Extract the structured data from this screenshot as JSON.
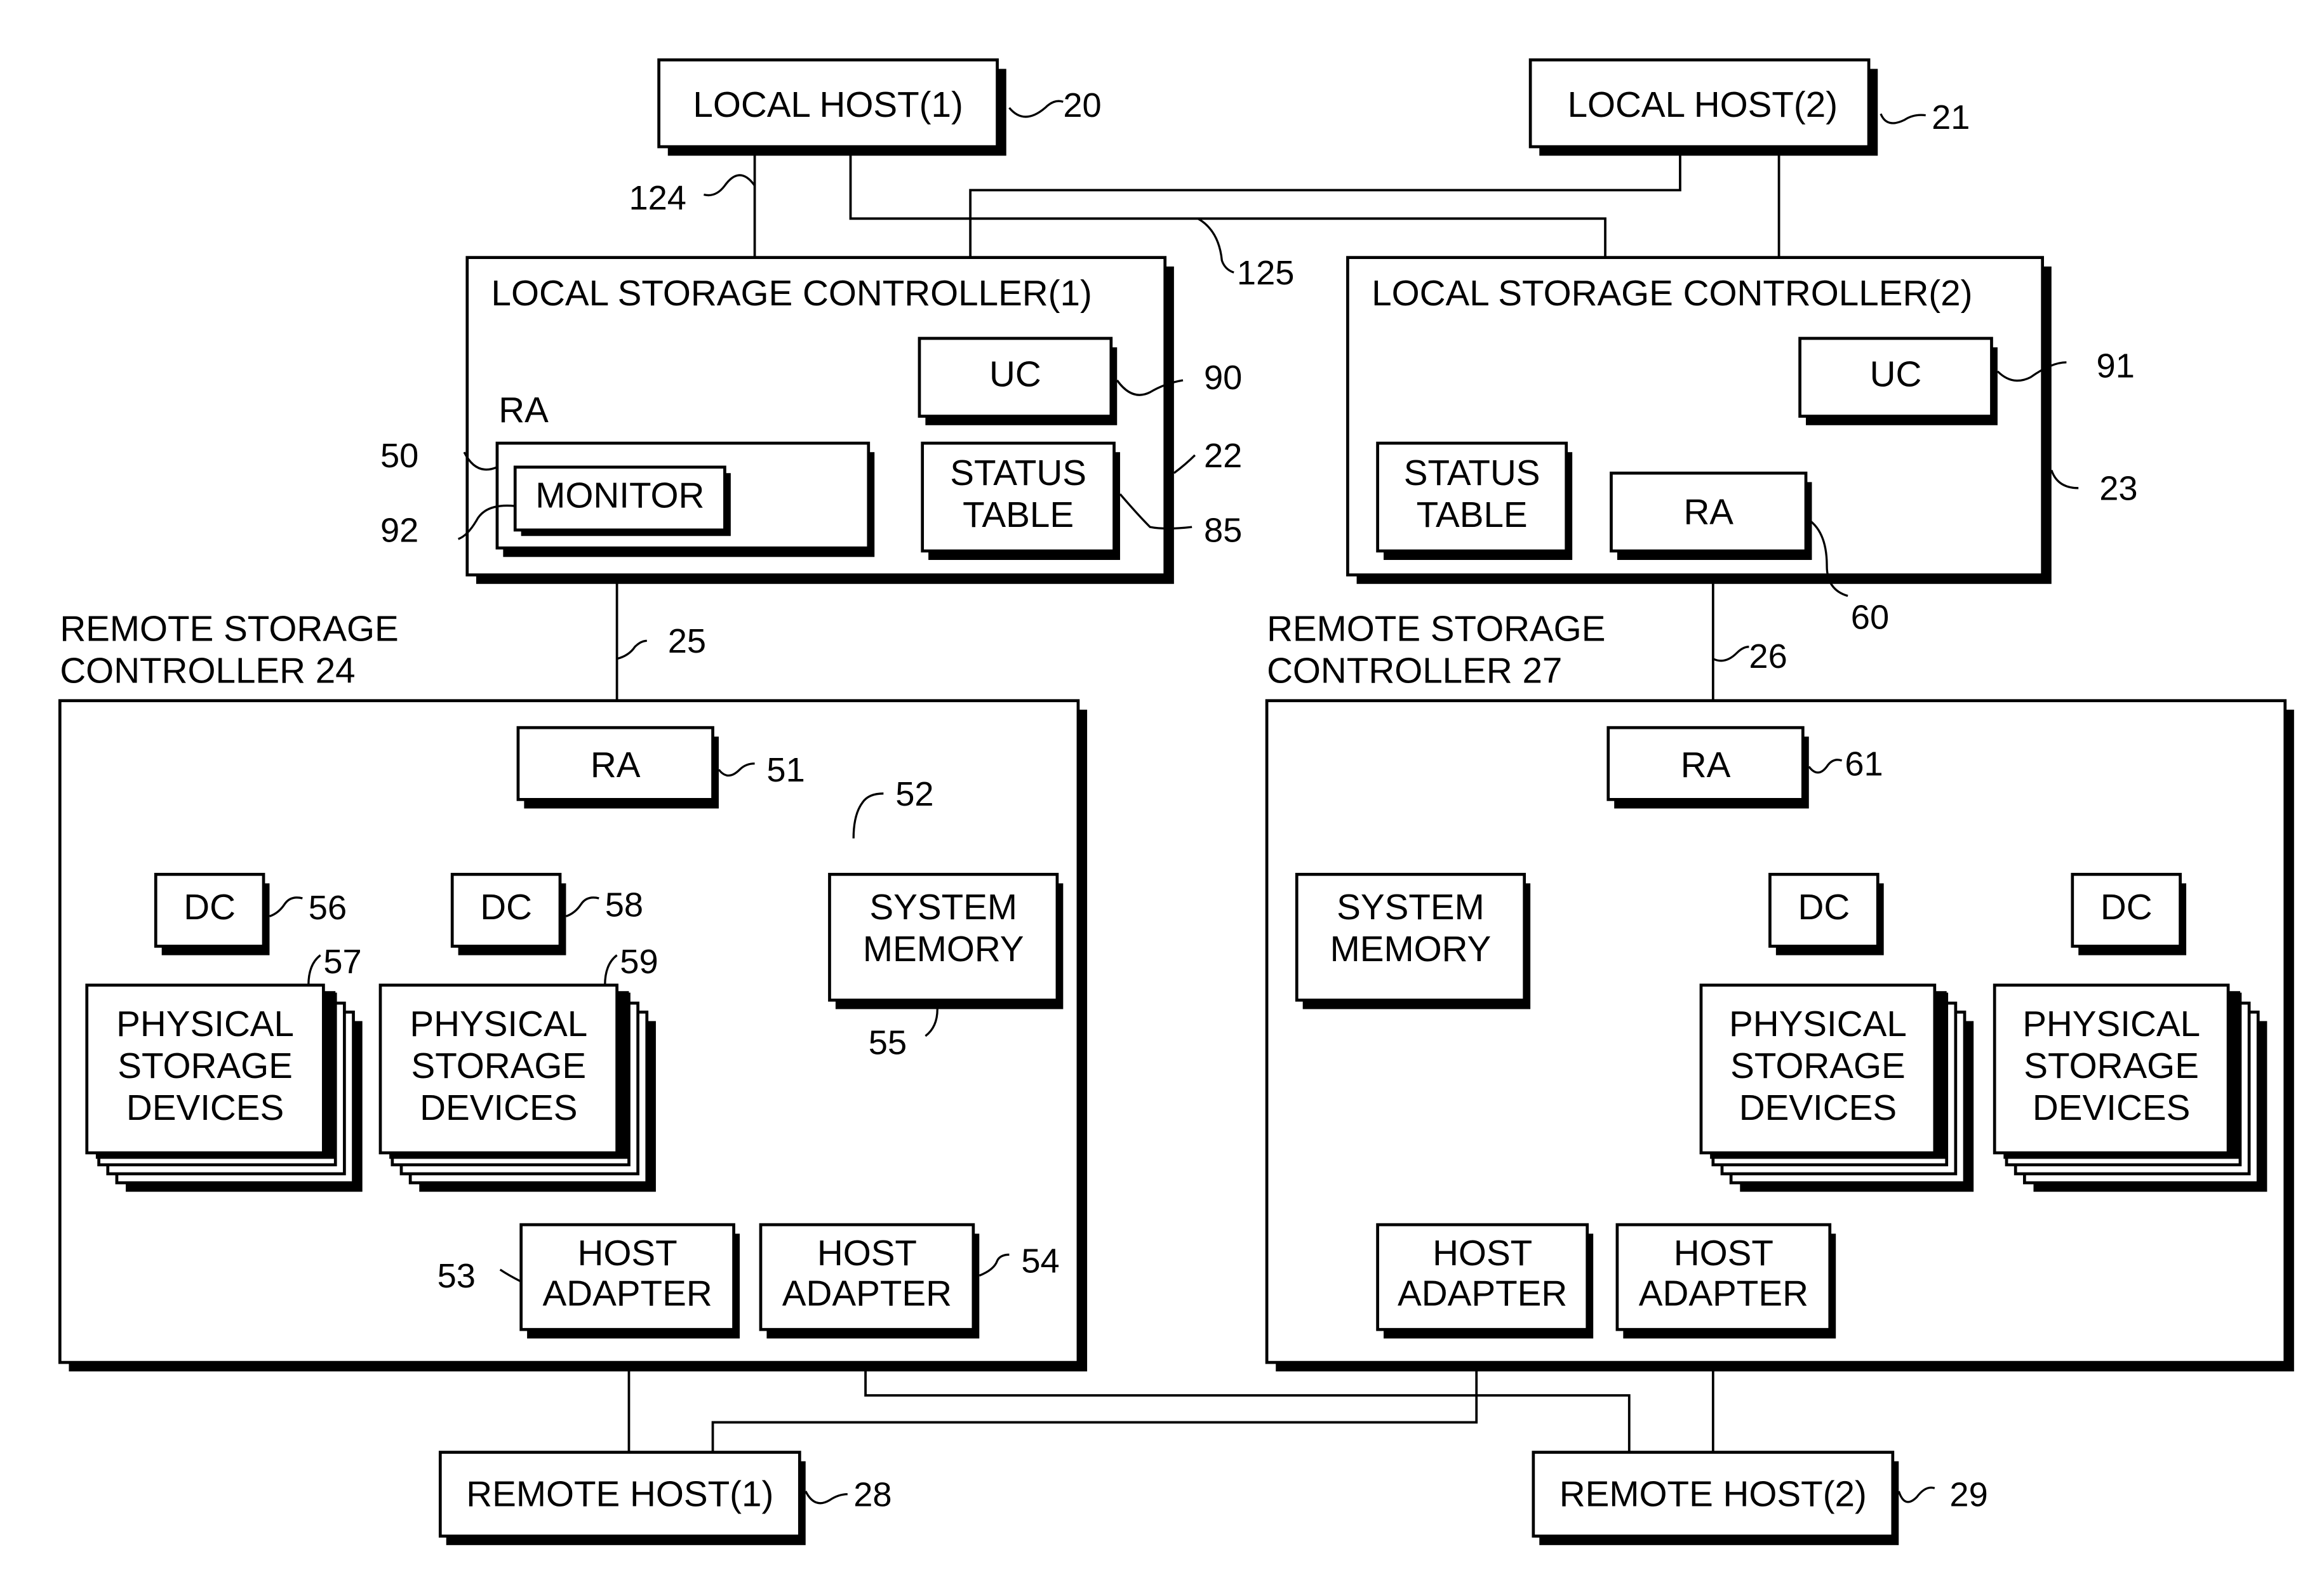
{
  "figure": {
    "local_host_1": {
      "label": "LOCAL HOST(1)",
      "ref": "20"
    },
    "local_host_2": {
      "label": "LOCAL HOST(2)",
      "ref": "21"
    },
    "link_124": "124",
    "link_125": "125",
    "lsc1": {
      "label": "LOCAL STORAGE CONTROLLER(1)",
      "ref": "22",
      "uc": {
        "label": "UC",
        "ref": "90"
      },
      "ra_caption": "RA",
      "ra_ref": "50",
      "monitor": {
        "label": "MONITOR",
        "ref": "92"
      },
      "status_table": {
        "line1": "STATUS",
        "line2": "TABLE",
        "ref": "85"
      }
    },
    "lsc2": {
      "label": "LOCAL STORAGE CONTROLLER(2)",
      "ref": "23",
      "uc": {
        "label": "UC",
        "ref": "91"
      },
      "status_table": {
        "line1": "STATUS",
        "line2": "TABLE"
      },
      "ra": {
        "label": "RA",
        "ref": "60"
      }
    },
    "link_25": "25",
    "link_26": "26",
    "rsc24": {
      "line1": "REMOTE STORAGE",
      "line2": "CONTROLLER 24",
      "ra": {
        "label": "RA",
        "ref": "51"
      },
      "bus_ref": "52",
      "dc_a": {
        "label": "DC",
        "ref": "56"
      },
      "dc_b": {
        "label": "DC",
        "ref": "58"
      },
      "psd_a": {
        "line1": "PHYSICAL",
        "line2": "STORAGE",
        "line3": "DEVICES",
        "ref": "57"
      },
      "psd_b": {
        "line1": "PHYSICAL",
        "line2": "STORAGE",
        "line3": "DEVICES",
        "ref": "59"
      },
      "sysmem": {
        "line1": "SYSTEM",
        "line2": "MEMORY",
        "ref": "55"
      },
      "ha_a": {
        "line1": "HOST",
        "line2": "ADAPTER",
        "ref": "53"
      },
      "ha_b": {
        "line1": "HOST",
        "line2": "ADAPTER",
        "ref": "54"
      }
    },
    "rsc27": {
      "line1": "REMOTE STORAGE",
      "line2": "CONTROLLER 27",
      "ra": {
        "label": "RA",
        "ref": "61"
      },
      "sysmem": {
        "line1": "SYSTEM",
        "line2": "MEMORY"
      },
      "dc_a": {
        "label": "DC"
      },
      "dc_b": {
        "label": "DC"
      },
      "psd_a": {
        "line1": "PHYSICAL",
        "line2": "STORAGE",
        "line3": "DEVICES"
      },
      "psd_b": {
        "line1": "PHYSICAL",
        "line2": "STORAGE",
        "line3": "DEVICES"
      },
      "ha_a": {
        "line1": "HOST",
        "line2": "ADAPTER"
      },
      "ha_b": {
        "line1": "HOST",
        "line2": "ADAPTER"
      }
    },
    "remote_host_1": {
      "label": "REMOTE HOST(1)",
      "ref": "28"
    },
    "remote_host_2": {
      "label": "REMOTE HOST(2)",
      "ref": "29"
    },
    "ellipsis": "• • •"
  }
}
